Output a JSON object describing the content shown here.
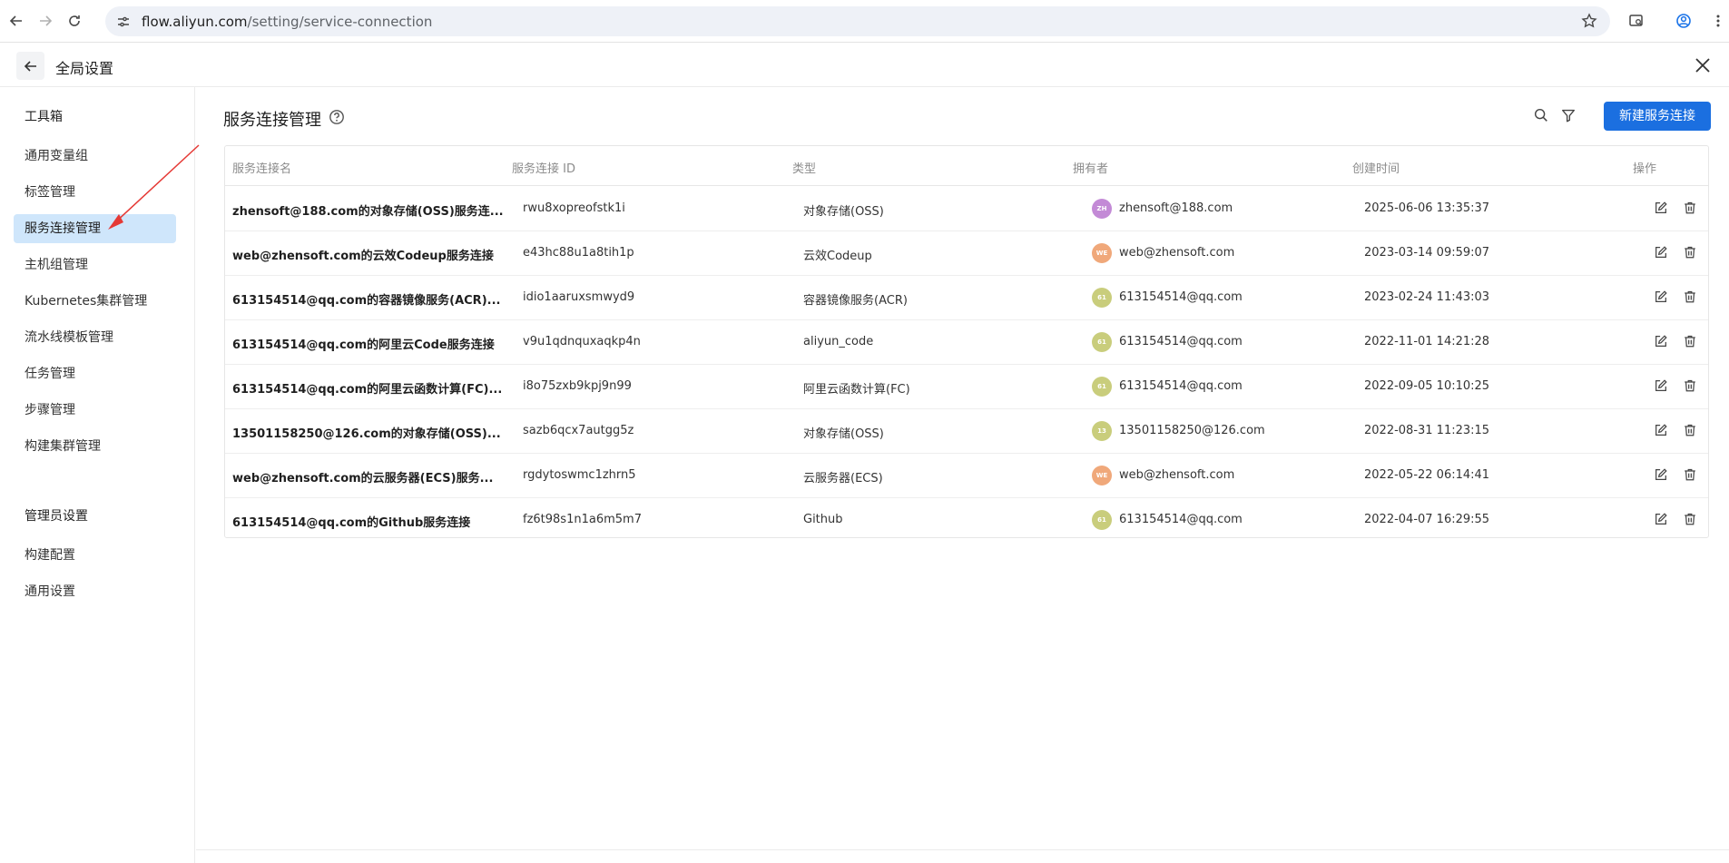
{
  "browser": {
    "url_host": "flow.aliyun.com",
    "url_path": "/setting/service-connection"
  },
  "header": {
    "title": "全局设置"
  },
  "sidebar": {
    "group1": "工具箱",
    "items": [
      {
        "label": "通用变量组"
      },
      {
        "label": "标签管理"
      },
      {
        "label": "服务连接管理"
      },
      {
        "label": "主机组管理"
      },
      {
        "label": "Kubernetes集群管理"
      },
      {
        "label": "流水线模板管理"
      },
      {
        "label": "任务管理"
      },
      {
        "label": "步骤管理"
      },
      {
        "label": "构建集群管理"
      }
    ],
    "group2": "管理员设置",
    "items2": [
      {
        "label": "构建配置"
      },
      {
        "label": "通用设置"
      }
    ]
  },
  "main": {
    "title": "服务连接管理",
    "new_button": "新建服务连接",
    "columns": {
      "name": "服务连接名",
      "id": "服务连接 ID",
      "type": "类型",
      "owner": "拥有者",
      "created": "创建时间",
      "actions": "操作"
    },
    "rows": [
      {
        "name": "zhensoft@188.com的对象存储(OSS)服务连...",
        "id": "rwu8xopreofstk1i",
        "type": "对象存储(OSS)",
        "avatar": "ZH",
        "avatar_color": "#c38ad6",
        "owner": "zhensoft@188.com",
        "created": "2025-06-06 13:35:37"
      },
      {
        "name": "web@zhensoft.com的云效Codeup服务连接",
        "id": "e43hc88u1a8tih1p",
        "type": "云效Codeup",
        "avatar": "WE",
        "avatar_color": "#f0a87a",
        "owner": "web@zhensoft.com",
        "created": "2023-03-14 09:59:07"
      },
      {
        "name": "613154514@qq.com的容器镜像服务(ACR)...",
        "id": "idio1aaruxsmwyd9",
        "type": "容器镜像服务(ACR)",
        "avatar": "61",
        "avatar_color": "#c9cd7c",
        "owner": "613154514@qq.com",
        "created": "2023-02-24 11:43:03"
      },
      {
        "name": "613154514@qq.com的阿里云Code服务连接",
        "id": "v9u1qdnquxaqkp4n",
        "type": "aliyun_code",
        "avatar": "61",
        "avatar_color": "#c9cd7c",
        "owner": "613154514@qq.com",
        "created": "2022-11-01 14:21:28"
      },
      {
        "name": "613154514@qq.com的阿里云函数计算(FC)...",
        "id": "i8o75zxb9kpj9n99",
        "type": "阿里云函数计算(FC)",
        "avatar": "61",
        "avatar_color": "#c9cd7c",
        "owner": "613154514@qq.com",
        "created": "2022-09-05 10:10:25"
      },
      {
        "name": "13501158250@126.com的对象存储(OSS)...",
        "id": "sazb6qcx7autgg5z",
        "type": "对象存储(OSS)",
        "avatar": "13",
        "avatar_color": "#c9cd7c",
        "owner": "13501158250@126.com",
        "created": "2022-08-31 11:23:15"
      },
      {
        "name": "web@zhensoft.com的云服务器(ECS)服务...",
        "id": "rgdytoswmc1zhrn5",
        "type": "云服务器(ECS)",
        "avatar": "WE",
        "avatar_color": "#f0a87a",
        "owner": "web@zhensoft.com",
        "created": "2022-05-22 06:14:41"
      },
      {
        "name": "613154514@qq.com的Github服务连接",
        "id": "fz6t98s1n1a6m5m7",
        "type": "Github",
        "avatar": "61",
        "avatar_color": "#c9cd7c",
        "owner": "613154514@qq.com",
        "created": "2022-04-07 16:29:55"
      }
    ]
  },
  "colors": {
    "accent": "#1b6fe0",
    "active_bg": "#cfe6fb",
    "annotation": "#e53935"
  }
}
